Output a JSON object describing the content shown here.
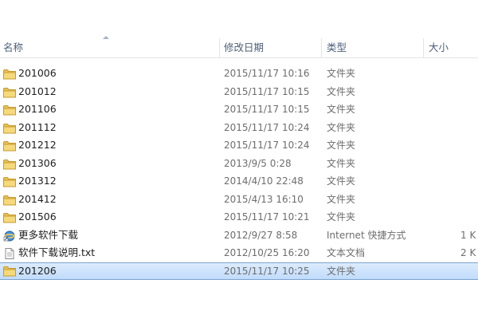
{
  "columns": {
    "name": "名称",
    "date": "修改日期",
    "type": "类型",
    "size": "大小"
  },
  "files": [
    {
      "name": "201006",
      "date": "2015/11/17 10:16",
      "type": "文件夹",
      "size": "",
      "icon": "folder-icon"
    },
    {
      "name": "201012",
      "date": "2015/11/17 10:15",
      "type": "文件夹",
      "size": "",
      "icon": "folder-icon"
    },
    {
      "name": "201106",
      "date": "2015/11/17 10:15",
      "type": "文件夹",
      "size": "",
      "icon": "folder-icon"
    },
    {
      "name": "201112",
      "date": "2015/11/17 10:24",
      "type": "文件夹",
      "size": "",
      "icon": "folder-icon"
    },
    {
      "name": "201212",
      "date": "2015/11/17 10:24",
      "type": "文件夹",
      "size": "",
      "icon": "folder-icon"
    },
    {
      "name": "201306",
      "date": "2013/9/5 0:28",
      "type": "文件夹",
      "size": "",
      "icon": "folder-icon"
    },
    {
      "name": "201312",
      "date": "2014/4/10 22:48",
      "type": "文件夹",
      "size": "",
      "icon": "folder-icon"
    },
    {
      "name": "201412",
      "date": "2015/4/13 16:10",
      "type": "文件夹",
      "size": "",
      "icon": "folder-icon"
    },
    {
      "name": "201506",
      "date": "2015/11/17 10:21",
      "type": "文件夹",
      "size": "",
      "icon": "folder-icon"
    },
    {
      "name": "更多软件下载",
      "date": "2012/9/27 8:58",
      "type": "Internet 快捷方式",
      "size": "1 K",
      "icon": "internet-shortcut-icon"
    },
    {
      "name": "软件下载说明.txt",
      "date": "2012/10/25 16:20",
      "type": "文本文档",
      "size": "2 K",
      "icon": "text-file-icon"
    },
    {
      "name": "201206",
      "date": "2015/11/17 10:25",
      "type": "文件夹",
      "size": "",
      "icon": "folder-icon",
      "selected": true
    }
  ]
}
